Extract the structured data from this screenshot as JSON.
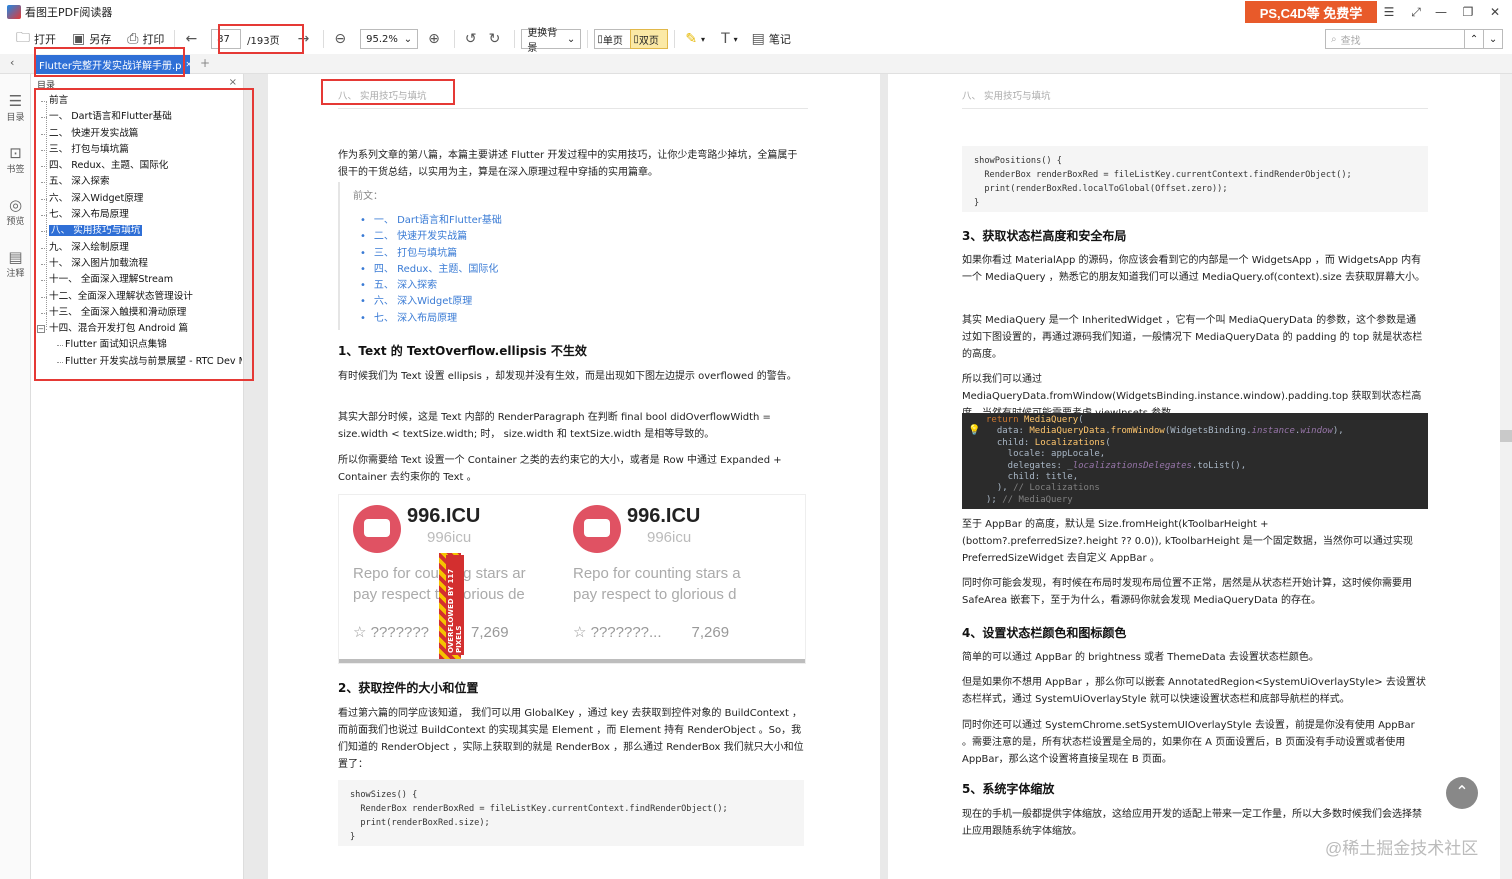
{
  "app": {
    "title": "看图王PDF阅读器",
    "promo": "PS,C4D等 免费学"
  },
  "window_controls": {
    "menu": "☰",
    "fullscreen": "⤢",
    "minimize": "—",
    "restore": "❐",
    "close": "✕"
  },
  "toolbar": {
    "open": "打开",
    "save_as": "另存",
    "print": "打印",
    "page_current": "87",
    "page_total": "/193页",
    "zoom": "95.2%",
    "background": "更换背景",
    "single": "单页",
    "double": "双页",
    "notes": "笔记",
    "search_placeholder": "查找"
  },
  "tab": {
    "label": "Flutter完整开发实战详解手册.p",
    "close": "✕",
    "add": "+"
  },
  "leftbar": [
    {
      "label": "目录",
      "icon": "☰"
    },
    {
      "label": "书签",
      "icon": "⊡"
    },
    {
      "label": "预览",
      "icon": "◎"
    },
    {
      "label": "注释",
      "icon": "▤"
    }
  ],
  "outline": {
    "title": "目录",
    "close": "×",
    "items": [
      "前言",
      "一、 Dart语言和Flutter基础",
      "二、 快速开发实战篇",
      "三、 打包与填坑篇",
      "四、 Redux、主题、国际化",
      "五、 深入探索",
      "六、 深入Widget原理",
      "七、 深入布局原理",
      "八、 实用技巧与填坑",
      "九、 深入绘制原理",
      "十、 深入图片加载流程",
      "十一、 全面深入理解Stream",
      "十二、全面深入理解状态管理设计",
      "十三、 全面深入触摸和滑动原理",
      "十四、混合开发打包 Android 篇",
      "Flutter 面试知识点集锦",
      "Flutter 开发实战与前景展望 - RTC Dev Meetup"
    ]
  },
  "page1": {
    "header": "八、 实用技巧与填坑",
    "intro": "作为系列文章的第八篇，本篇主要讲述 Flutter 开发过程中的实用技巧，让你少走弯路少掉坑，全篇属于很干的干货总结，以实用为主，算是在深入原理过程中穿插的实用篇章。",
    "toc_label": "前文：",
    "toc": [
      "一、 Dart语言和Flutter基础",
      "二、 快速开发实战篇",
      "三、 打包与填坑篇",
      "四、 Redux、主题、国际化",
      "五、 深入探索",
      "六、 深入Widget原理",
      "七、 深入布局原理"
    ],
    "s1_title": "1、Text 的 TextOverflow.ellipsis 不生效",
    "s1_p1": "有时候我们为 Text 设置 ellipsis ，却发现并没有生效，而是出现如下图左边提示 overflowed 的警告。",
    "s1_p2": "其实大部分时候，这是 Text 内部的 RenderParagraph 在判断 final bool didOverflowWidth = size.width < textSize.width; 时， size.width 和 textSize.width 是相等导致的。",
    "s1_p3": "所以你需要给 Text 设置一个 Container 之类的去约束它的大小，或者是 Row 中通过 Expanded + Container 去约束你的 Text 。",
    "card": {
      "title": "996.ICU",
      "sub": "996icu",
      "desc1": "Repo for counting stars ar",
      "desc2": "pay respect to glorious de",
      "stat_left": "☆  ???????",
      "stat_right": "7,269",
      "overflow": "OVERFLOWED BY 117 PIXELS"
    },
    "card2": {
      "desc1": "Repo for counting stars a",
      "desc2": "pay respect to glorious d",
      "stat_left": "☆  ???????...",
      "stat_right": "7,269"
    },
    "s2_title": "2、获取控件的大小和位置",
    "s2_p1": "看过第六篇的同学应该知道， 我们可以用 GlobalKey ，通过 key 去获取到控件对象的 BuildContext ，而前面我们也说过 BuildContext 的实现其实是 Element ，而 Element 持有 RenderObject 。So，我们知道的 RenderObject ，实际上获取到的就是 RenderBox ，那么通过 RenderBox 我们就只大小和位置了：",
    "code1": "showSizes() {\n  RenderBox renderBoxRed = fileListKey.currentContext.findRenderObject();\n  print(renderBoxRed.size);\n}"
  },
  "page2": {
    "header": "八、 实用技巧与填坑",
    "code2": "showPositions() {\n  RenderBox renderBoxRed = fileListKey.currentContext.findRenderObject();\n  print(renderBoxRed.localToGlobal(Offset.zero));\n}",
    "s3_title": "3、获取状态栏高度和安全布局",
    "s3_p1": "如果你看过 MaterialApp 的源码，你应该会看到它的内部是一个 WidgetsApp ，而 WidgetsApp 内有一个 MediaQuery ，熟悉它的朋友知道我们可以通过 MediaQuery.of(context).size 去获取屏幕大小。",
    "s3_p2": "其实 MediaQuery 是一个 InheritedWidget ，它有一个叫 MediaQueryData 的参数，这个参数是通过如下图设置的，再通过源码我们知道，一般情况下 MediaQueryData 的 padding 的 top 就是状态栏的高度。",
    "s3_p3": "所以我们可以通过 MediaQueryData.fromWindow(WidgetsBinding.instance.window).padding.top 获取到状态栏高度，当然有时候可能需要考虑 viewInsets 参数。",
    "s3_p4": "至于 AppBar 的高度，默认是 Size.fromHeight(kToolbarHeight + (bottom?.preferredSize?.height ?? 0.0)), kToolbarHeight 是一个固定数据，当然你可以通过实现 PreferredSizeWidget 去自定义 AppBar 。",
    "s3_p5": "同时你可能会发现，有时候在布局时发现布局位置不正常，居然是从状态栏开始计算，这时候你需要用 SafeArea 嵌套下，至于为什么，看源码你就会发现 MediaQueryData 的存在。",
    "s4_title": "4、设置状态栏颜色和图标颜色",
    "s4_p1": "简单的可以通过 AppBar 的 brightness 或者 ThemeData 去设置状态栏颜色。",
    "s4_p2": "但是如果你不想用 AppBar ，那么你可以嵌套 AnnotatedRegion<SystemUiOverlayStyle> 去设置状态栏样式，通过 SystemUiOverlayStyle 就可以快速设置状态栏和底部导航栏的样式。",
    "s4_p3": "同时你还可以通过 SystemChrome.setSystemUIOverlayStyle 去设置，前提是你没有使用 AppBar 。需要注意的是，所有状态栏设置是全局的，如果你在 A 页面设置后，B 页面没有手动设置或者使用 AppBar，那么这个设置将直接呈现在 B 页面。",
    "s5_title": "5、系统字体缩放",
    "s5_p1": "现在的手机一般都提供字体缩放，这给应用开发的适配上带来一定工作量，所以大多数时候我们会选择禁止应用跟随系统字体缩放。"
  },
  "watermark": "@稀土掘金技术社区",
  "scrolltop": "⌃"
}
